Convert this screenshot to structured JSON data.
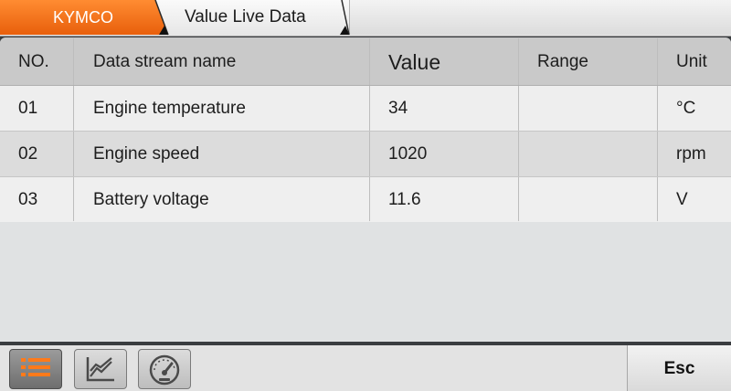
{
  "breadcrumb": {
    "brand": "KYMCO",
    "page": "Value Live Data"
  },
  "table": {
    "headers": {
      "no": "NO.",
      "name": "Data stream name",
      "value": "Value",
      "range": "Range",
      "unit": "Unit"
    },
    "rows": [
      {
        "no": "01",
        "name": "Engine temperature",
        "value": "34",
        "range": "",
        "unit": "°C"
      },
      {
        "no": "02",
        "name": "Engine speed",
        "value": "1020",
        "range": "",
        "unit": "rpm"
      },
      {
        "no": "03",
        "name": "Battery voltage",
        "value": "11.6",
        "range": "",
        "unit": "V"
      }
    ]
  },
  "toolbar": {
    "tools": [
      {
        "icon": "list-icon",
        "active": true
      },
      {
        "icon": "line-chart-icon",
        "active": false
      },
      {
        "icon": "gauge-icon",
        "active": false
      }
    ],
    "esc_label": "Esc"
  },
  "colors": {
    "accent": "#f07020",
    "header_row": "#c9c9c9",
    "row_light": "#eeeeee",
    "row_dark": "#dcdcdc"
  }
}
